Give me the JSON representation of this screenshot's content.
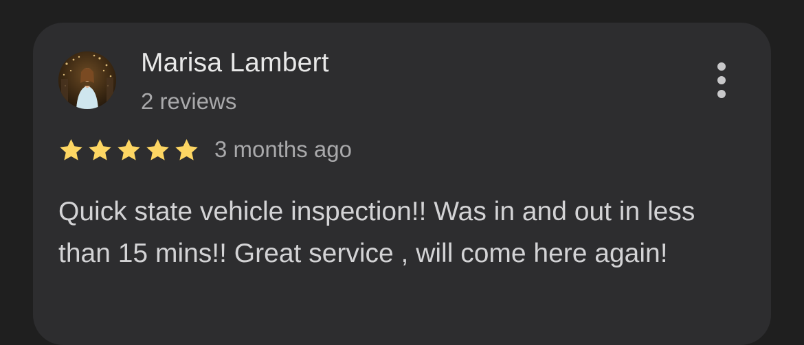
{
  "review": {
    "reviewer_name": "Marisa Lambert",
    "review_count": "2 reviews",
    "rating": 5,
    "rating_max": 5,
    "time_ago": "3 months ago",
    "text": "Quick state vehicle inspection!! Was in and out in less than 15 mins!! Great service , will come here again!"
  },
  "icons": {
    "star": "star-icon",
    "more": "more-vert-icon"
  },
  "colors": {
    "background": "#1f1f1f",
    "card": "#2d2d2f",
    "star": "#fdd663",
    "primary_text": "#e8e8e8",
    "secondary_text": "#a9a9ab",
    "body_text": "#d3d3d5"
  }
}
